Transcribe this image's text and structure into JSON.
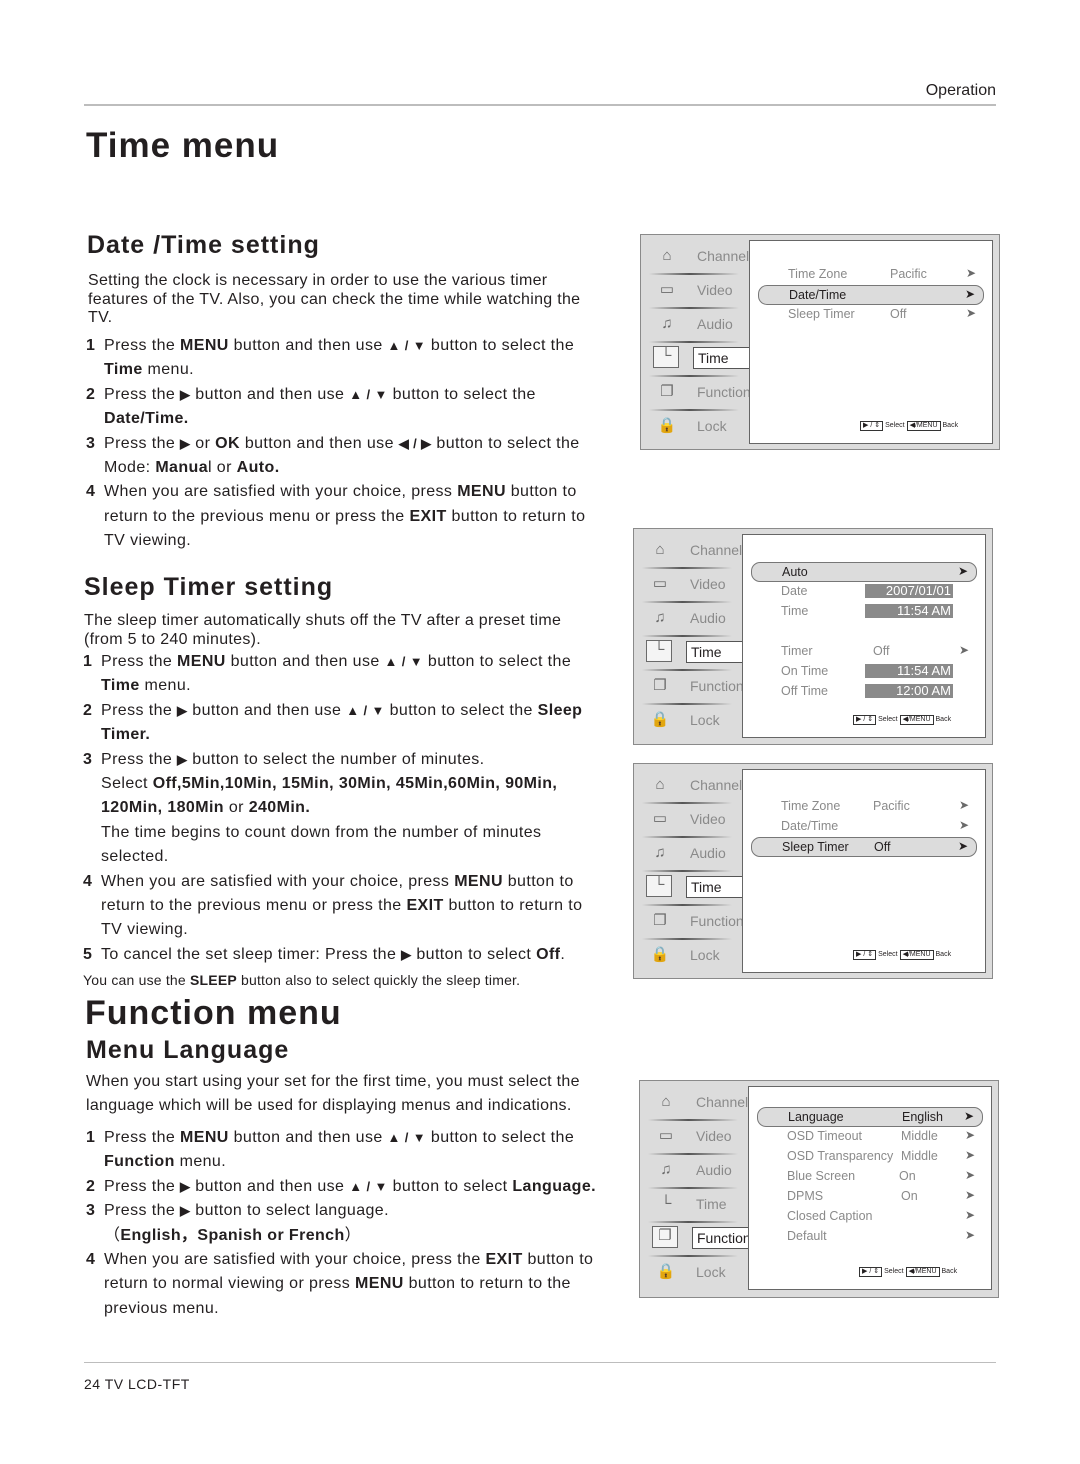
{
  "header": {
    "section": "Operation"
  },
  "footer": {
    "page_label": "24  TV LCD-TFT"
  },
  "time_menu": {
    "title": "Time menu",
    "date_time": {
      "heading": "Date /Time setting",
      "intro": "Setting the clock is necessary in order to use the various timer features of the TV. Also, you can check the time while watching the TV.",
      "steps": [
        {
          "num": "1",
          "parts": [
            "Press the ",
            "MENU",
            " button and then use ",
            "▲ / ▼",
            " button to select the ",
            "Time",
            " menu."
          ]
        },
        {
          "num": "2",
          "parts": [
            "Press the ",
            "▶",
            " button and then use ",
            "▲ / ▼",
            " button to select the ",
            "Date/Time."
          ]
        },
        {
          "num": "3",
          "parts": [
            "Press the ",
            "▶",
            " or ",
            "OK",
            " button and then use ",
            "◀ / ▶",
            " button to select the Mode: ",
            "Manua",
            "l or ",
            "Auto."
          ]
        },
        {
          "num": "4",
          "parts": [
            "When you are satisfied with your choice,  press ",
            "MENU",
            " button to return to the previous menu or press the ",
            "EXIT",
            " button to return to TV viewing."
          ]
        }
      ]
    },
    "sleep_timer": {
      "heading": "Sleep Timer setting",
      "intro": "The sleep timer automatically shuts off the TV after a preset time (from 5 to 240 minutes).",
      "steps": [
        {
          "num": "1",
          "parts": [
            "Press the ",
            "MENU",
            " button and then use ",
            "▲ / ▼",
            " button to select the ",
            "Time",
            " menu."
          ]
        },
        {
          "num": "2",
          "parts": [
            "Press the ",
            "▶",
            " button and then use ",
            "▲ / ▼",
            " button to select the ",
            "Sleep Timer."
          ]
        },
        {
          "num": "3",
          "parts": [
            "Press the ",
            "▶",
            " button  to select the number of minutes."
          ]
        },
        {
          "num": "",
          "parts": [
            "Select ",
            "Off,5Min,10Min, 15Min, 30Min, 45Min,60Min, 90Min, 120Min, 180Min",
            " or ",
            "240Min."
          ]
        },
        {
          "num": "",
          "parts": [
            "The time begins to count down from the number of minutes selected."
          ]
        },
        {
          "num": "4",
          "parts": [
            "When you are satisfied with your choice,  press ",
            "MENU",
            " button to return to the previous menu or press the ",
            "EXIT",
            " button to return to TV viewing."
          ]
        },
        {
          "num": "5",
          "parts": [
            "To cancel the set sleep timer: Press the ",
            "▶",
            "  button to select  ",
            "Off",
            "."
          ]
        }
      ],
      "note_parts": [
        "You can use the ",
        "SLEEP",
        " button also to select quickly the sleep timer."
      ]
    }
  },
  "function_menu": {
    "title": "Function menu",
    "language": {
      "heading": "Menu Language",
      "intro": "When you start using your set for the first time, you must select the language which will be used for displaying menus and indications.",
      "steps": [
        {
          "num": "1",
          "parts": [
            "Press the ",
            "MENU",
            " button and then use ",
            "▲ / ▼",
            " button to select the ",
            "Function",
            " menu."
          ]
        },
        {
          "num": "2",
          "parts": [
            "Press the ",
            "▶",
            " button and then use ",
            "▲ / ▼",
            " button to select ",
            "Language."
          ]
        },
        {
          "num": "3",
          "parts": [
            "Press the ",
            "▶",
            " button  to select  language."
          ]
        },
        {
          "num": "",
          "parts": [
            "（",
            "English，Spanish or French",
            "）"
          ]
        },
        {
          "num": "4",
          "parts": [
            "When you are satisfied with your choice, press the ",
            "EXIT",
            " button to return to normal viewing or press ",
            "MENU",
            " button to return to the previous menu."
          ]
        }
      ]
    }
  },
  "osd": {
    "sidebar": [
      {
        "label": "Channel",
        "icon": "satellite-dish-icon",
        "glyph": "⌂"
      },
      {
        "label": "Video",
        "icon": "monitor-icon",
        "glyph": "▭"
      },
      {
        "label": "Audio",
        "icon": "audio-icon",
        "glyph": "♫"
      },
      {
        "label": "Time",
        "icon": "clock-icon",
        "glyph": "└"
      },
      {
        "label": "Function",
        "icon": "function-box-icon",
        "glyph": "❐"
      },
      {
        "label": "Lock",
        "icon": "lock-icon",
        "glyph": "🔒"
      }
    ],
    "hint": {
      "keys1": "▶ / ⇕",
      "select": "Select",
      "keys2": "◀/MENU",
      "back": "Back"
    },
    "panels": [
      {
        "active": "Time",
        "rows": [
          {
            "key": "Time Zone",
            "value": "Pacific",
            "arrow": "➤",
            "selected": false
          },
          {
            "key": "Date/Time",
            "value": "",
            "arrow": "➤",
            "selected": true
          },
          {
            "key": "Sleep Timer",
            "value": "Off",
            "arrow": "➤",
            "selected": false
          }
        ]
      },
      {
        "active": "Time",
        "rows": [
          {
            "key": "Auto",
            "value": "",
            "arrow": "➤",
            "selected": true
          },
          {
            "key": "Date",
            "value": "2007/01/01",
            "boxed": true
          },
          {
            "key": "Time",
            "value": "11:54   AM",
            "boxed": true
          },
          {
            "key": "Timer",
            "value": "Off",
            "arrow": "➤"
          },
          {
            "key": "On Time",
            "value": "11:54   AM",
            "boxed": true
          },
          {
            "key": "Off Time",
            "value": "12:00   AM",
            "boxed": true
          }
        ]
      },
      {
        "active": "Time",
        "rows": [
          {
            "key": "Time Zone",
            "value": "Pacific",
            "arrow": "➤",
            "selected": false
          },
          {
            "key": "Date/Time",
            "value": "",
            "arrow": "➤",
            "selected": false
          },
          {
            "key": "Sleep Timer",
            "value": "Off",
            "arrow": "➤",
            "selected": true
          }
        ]
      },
      {
        "active": "Function",
        "rows": [
          {
            "key": "Language",
            "value": "English",
            "arrow": "➤",
            "selected": true
          },
          {
            "key": "OSD Timeout",
            "value": "Middle",
            "arrow": "➤"
          },
          {
            "key": "OSD Transparency",
            "value": "Middle",
            "arrow": "➤"
          },
          {
            "key": "Blue Screen",
            "value": "On",
            "arrow": "➤"
          },
          {
            "key": "DPMS",
            "value": "On",
            "arrow": "➤"
          },
          {
            "key": "Closed Caption",
            "value": "",
            "arrow": "➤"
          },
          {
            "key": "Default",
            "value": "",
            "arrow": "➤"
          }
        ]
      }
    ]
  }
}
